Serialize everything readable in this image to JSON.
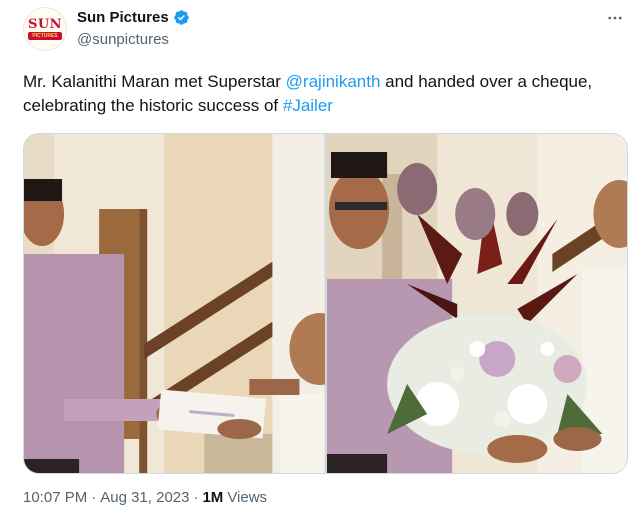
{
  "author": {
    "display_name": "Sun Pictures",
    "handle": "@sunpictures",
    "avatar_text": "SUN",
    "avatar_subtext": "PICTURES",
    "verified": true
  },
  "tweet": {
    "text_part1": "Mr. Kalanithi Maran met Superstar ",
    "mention": "@rajinikanth",
    "text_part2": " and handed over a cheque, celebrating the historic success of ",
    "hashtag": "#Jailer"
  },
  "footer": {
    "time": "10:07 PM",
    "separator": "·",
    "date": "Aug 31, 2023",
    "views_count": "1M",
    "views_label": "Views"
  },
  "colors": {
    "link": "#1d9bf0",
    "verified": "#1d9bf0",
    "secondary_text": "#536471"
  },
  "icons": {
    "verified": "verified-badge-icon",
    "more": "more-icon"
  }
}
